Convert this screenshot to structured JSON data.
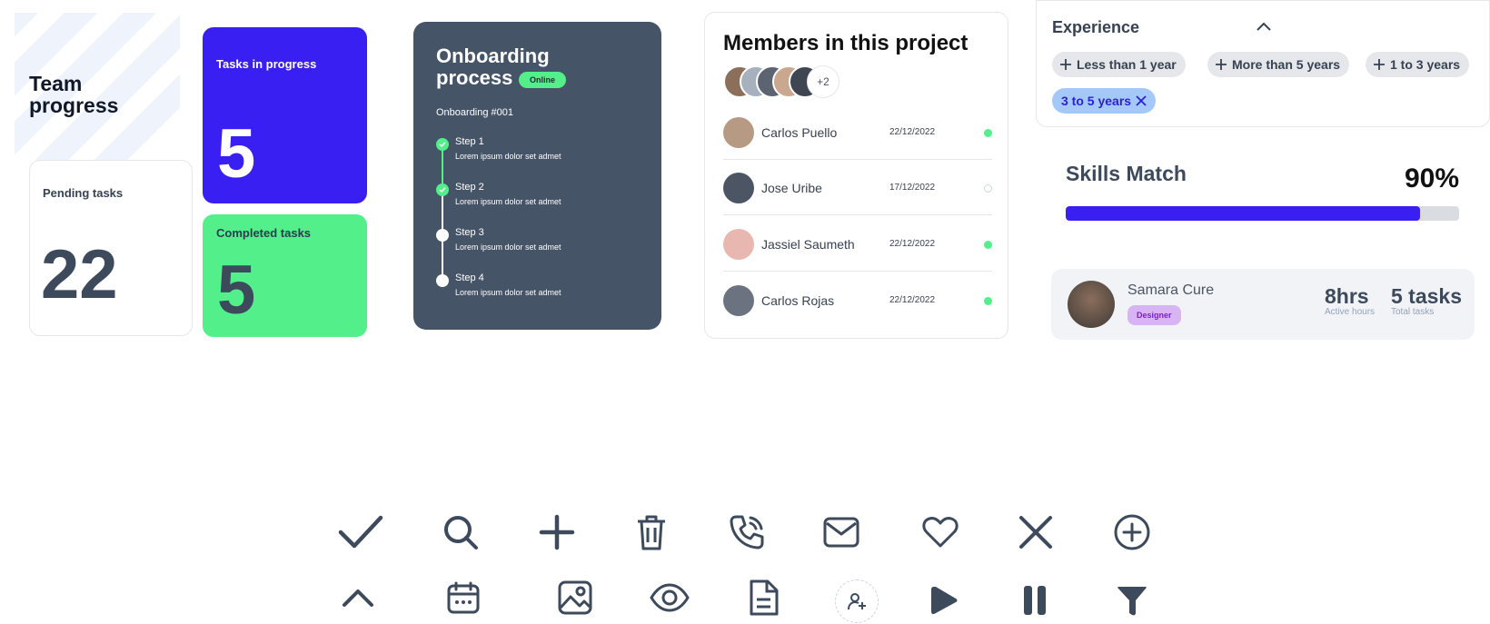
{
  "team": {
    "title": "Team progress",
    "pending": {
      "label": "Pending tasks",
      "value": "22"
    },
    "in_progress": {
      "label": "Tasks in progress",
      "value": "5"
    },
    "completed": {
      "label": "Completed tasks",
      "value": "5"
    }
  },
  "onboarding": {
    "title": "Onboarding process",
    "status": "Online",
    "subtitle": "Onboarding #001",
    "steps": [
      {
        "name": "Step 1",
        "desc": "Lorem ipsum dolor set admet",
        "done": true
      },
      {
        "name": "Step 2",
        "desc": "Lorem ipsum dolor set admet",
        "done": true
      },
      {
        "name": "Step 3",
        "desc": "Lorem ipsum dolor set admet",
        "done": false
      },
      {
        "name": "Step 4",
        "desc": "Lorem ipsum dolor set admet",
        "done": false
      }
    ]
  },
  "members": {
    "title": "Members in this project",
    "more": "+2",
    "list": [
      {
        "name": "Carlos Puello",
        "date": "22/12/2022",
        "online": true
      },
      {
        "name": "Jose Uribe",
        "date": "17/12/2022",
        "online": false
      },
      {
        "name": "Jassiel Saumeth",
        "date": "22/12/2022",
        "online": true
      },
      {
        "name": "Carlos Rojas",
        "date": "22/12/2022",
        "online": true
      }
    ]
  },
  "experience": {
    "title": "Experience",
    "options": [
      "Less than 1 year",
      "More than 5 years",
      "1 to 3 years"
    ],
    "selected": "3 to 5 years"
  },
  "skills": {
    "title": "Skills Match",
    "value_label": "90%",
    "value": 0.9
  },
  "profile": {
    "name": "Samara Cure",
    "role": "Designer",
    "hours": "8hrs",
    "hours_label": "Active hours",
    "tasks": "5 tasks",
    "tasks_label": "Total tasks"
  },
  "icons": {
    "row1": [
      "check-icon",
      "search-icon",
      "plus-icon",
      "trash-icon",
      "phone-icon",
      "mail-icon",
      "heart-icon",
      "close-icon",
      "plus-circle-icon"
    ],
    "row2": [
      "chevron-up-icon",
      "calendar-icon",
      "image-icon",
      "eye-icon",
      "document-icon",
      "add-user-icon",
      "play-icon",
      "pause-icon",
      "filter-icon"
    ]
  },
  "colors": {
    "primary": "#3a1ff2",
    "success": "#52ef8b",
    "dark": "#465467",
    "chip": "#e5e7eb",
    "chip_selected": "#a5c8fb"
  }
}
